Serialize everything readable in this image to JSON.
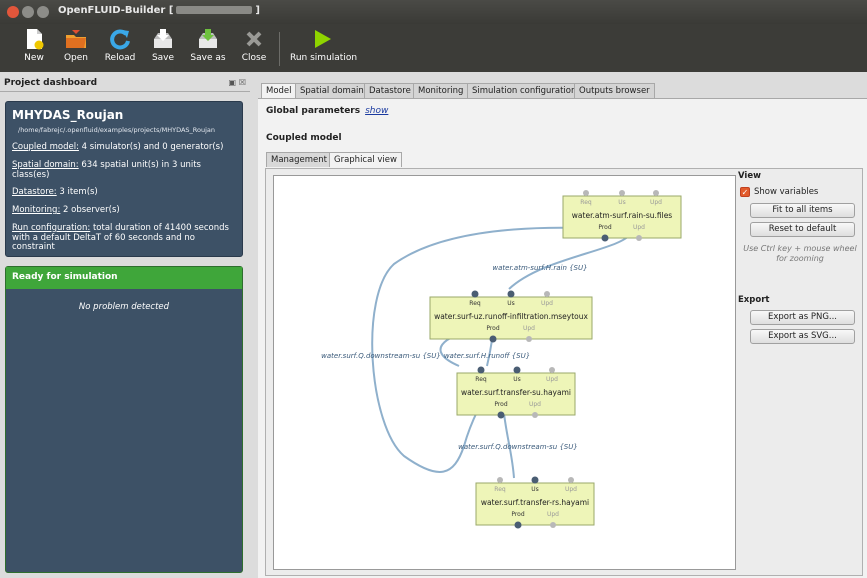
{
  "window": {
    "title_prefix": "OpenFLUID-Builder [",
    "title_suffix": "]"
  },
  "toolbar": {
    "new": "New",
    "open": "Open",
    "reload": "Reload",
    "save": "Save",
    "save_as": "Save as",
    "close": "Close",
    "run": "Run simulation"
  },
  "dashboard": {
    "header": "Project dashboard",
    "project_name": "MHYDAS_Roujan",
    "project_path": "/home/fabrejc/.openfluid/examples/projects/MHYDAS_Roujan",
    "coupled_model_label": "Coupled model:",
    "coupled_model_value": " 4 simulator(s) and 0 generator(s)",
    "spatial_label": "Spatial domain:",
    "spatial_value": " 634 spatial unit(s) in 3 units class(es)",
    "datastore_label": "Datastore:",
    "datastore_value": " 3 item(s)",
    "monitoring_label": "Monitoring:",
    "monitoring_value": " 2 observer(s)",
    "run_label": "Run configuration:",
    "run_value": " total duration of 41400 seconds with a default DeltaT of 60 seconds and no constraint",
    "ready_header": "Ready for simulation",
    "no_problem": "No problem detected"
  },
  "tabs": [
    "Model",
    "Spatial domain",
    "Datastore",
    "Monitoring",
    "Simulation configuration",
    "Outputs browser"
  ],
  "model": {
    "global_params": "Global parameters",
    "show_link": "show",
    "coupled_model": "Coupled model",
    "subtabs": [
      "Management",
      "Graphical view"
    ]
  },
  "graph": {
    "nodes": [
      {
        "name": "water.atm-surf.rain-su.files"
      },
      {
        "name": "water.surf-uz.runoff-infiltration.mseytoux"
      },
      {
        "name": "water.surf.transfer-su.hayami"
      },
      {
        "name": "water.surf.transfer-rs.hayami"
      }
    ],
    "ports": {
      "req": "Req",
      "us": "Us",
      "upd": "Upd",
      "prod": "Prod"
    },
    "edge_labels": [
      "water.atm-surf.H.rain {SU}",
      "water.surf.Q.downstream-su {SU}",
      "water.surf.H.runoff {SU}",
      "water.surf.Q.downstream-su {SU}"
    ]
  },
  "view": {
    "title": "View",
    "show_variables": "Show variables",
    "fit_button": "Fit to all items",
    "reset_button": "Reset to default",
    "hint": "Use Ctrl key + mouse wheel for zooming"
  },
  "export": {
    "title": "Export",
    "png_button": "Export as PNG...",
    "svg_button": "Export as SVG..."
  },
  "colors": {
    "node_fill": "#eef5b8",
    "node_border": "#9aa86a",
    "edge": "#8fb0cc",
    "active_port": "#4a5d73",
    "inactive_port": "#b8b8b8",
    "ready_green": "#3fa63a",
    "panel_blue": "#3d5166"
  }
}
